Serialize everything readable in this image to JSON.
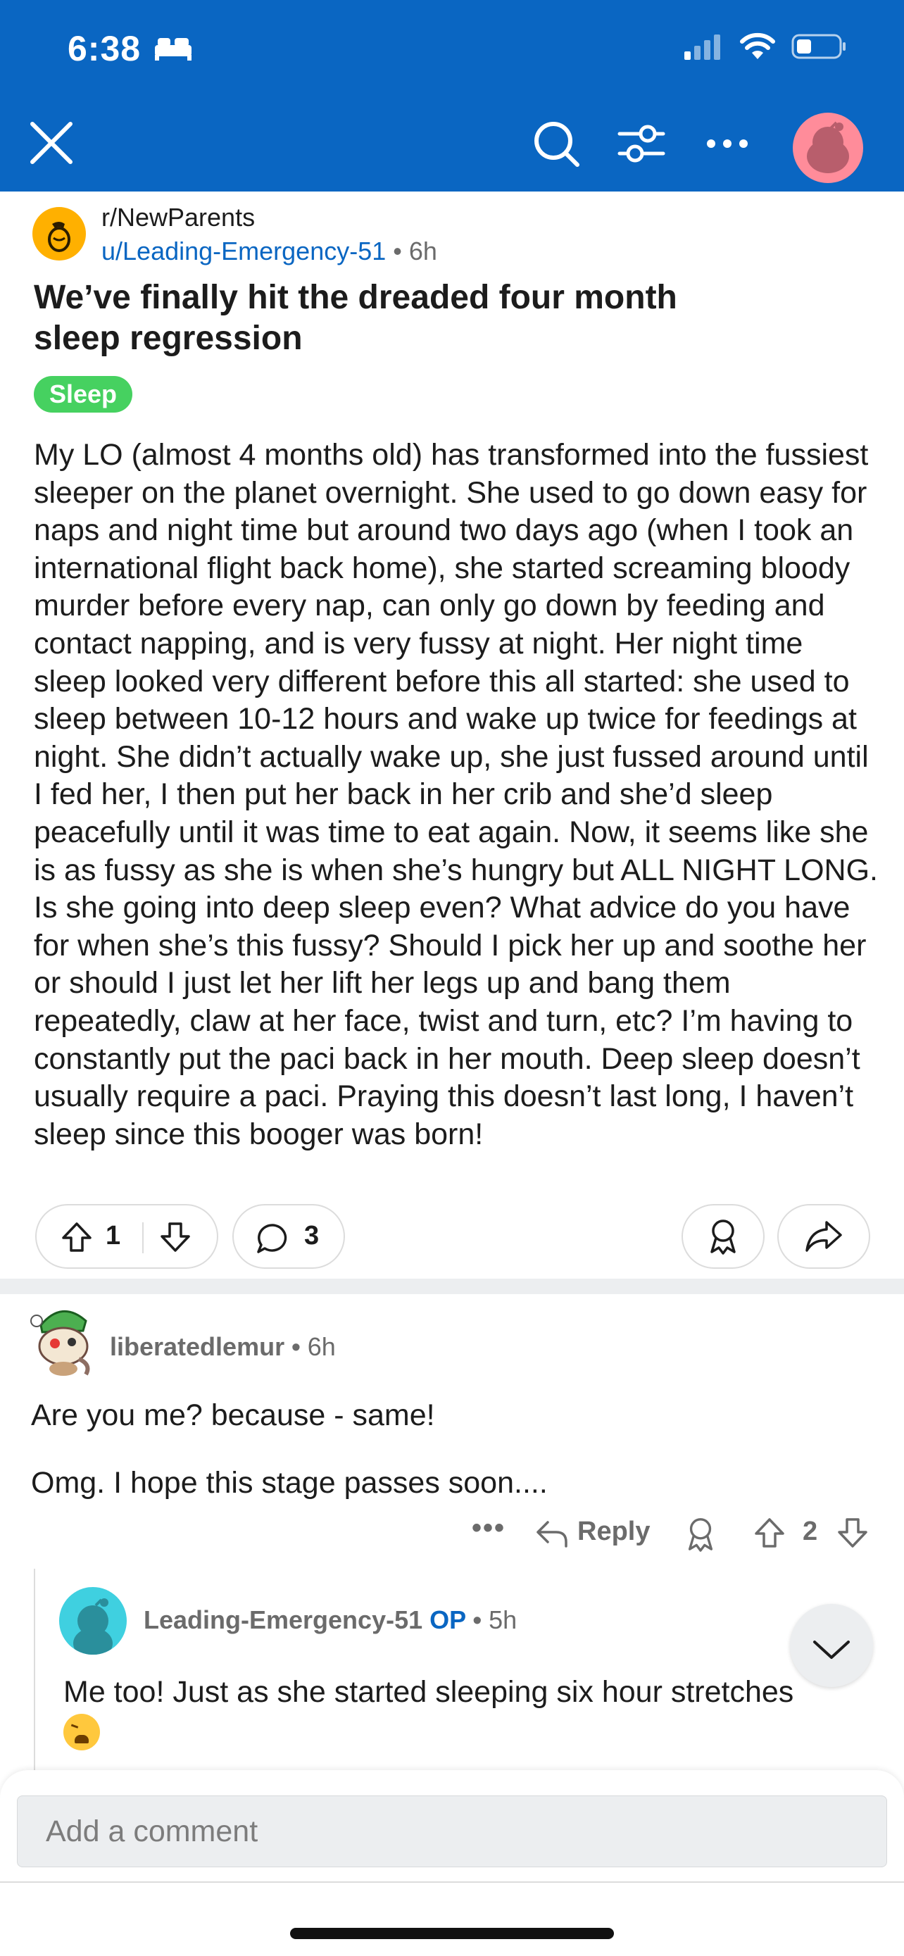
{
  "status_bar": {
    "time": "6:38"
  },
  "nav": {
    "icons": [
      "close-icon",
      "search-icon",
      "filter-icon",
      "more-icon",
      "avatar"
    ]
  },
  "post": {
    "subreddit": "r/NewParents",
    "author": "u/Leading-Emergency-51",
    "separator": "•",
    "age": "6h",
    "title": "We’ve finally hit the dreaded four month sleep regression",
    "flair": "Sleep",
    "flair_color": "#46d160",
    "body": "My LO (almost 4 months old) has transformed into the fussiest sleeper on the planet overnight. She used to go down easy for naps and night time but around two days ago (when I took an international flight back home), she started screaming bloody murder before every nap, can only go down by feeding and contact napping, and is very fussy at night. Her night time sleep looked very different before this all started: she used to sleep between 10-12 hours and wake up twice for feedings at night. She didn’t actually wake up, she just fussed around until I fed her, I then put her back in her crib and she’d sleep peacefully until it was time to eat again. Now, it seems like she is as fussy as she is when she’s hungry but ALL NIGHT LONG. Is she going into deep sleep even? What advice do you have for when she’s this fussy? Should I pick her up and soothe her or should I just let her lift her legs up and bang them repeatedly, claw at her face, twist and turn, etc? I’m having to constantly put the paci back in her mouth. Deep sleep doesn’t usually require a paci. Praying this doesn’t last long, I haven’t sleep since this booger was born!",
    "vote_count": "1",
    "comment_count": "3"
  },
  "comments": [
    {
      "username": "liberatedlemur",
      "separator": "•",
      "age": "6h",
      "line1": "Are you me? because - same!",
      "line2": "Omg. I hope this stage passes soon....",
      "more": "•••",
      "reply_label": "Reply",
      "vote_count": "2"
    },
    {
      "username": "Leading-Emergency-51",
      "op_badge": "OP",
      "separator": "•",
      "age": "5h",
      "text": "Me too! Just as she started sleeping six hour stretches",
      "emoji": "tired-face-emoji"
    }
  ],
  "composer": {
    "placeholder": "Add a comment"
  },
  "colors": {
    "header_bg": "#0a66c2",
    "accent_blue": "#0a66c2",
    "muted": "#6b6b6b"
  }
}
